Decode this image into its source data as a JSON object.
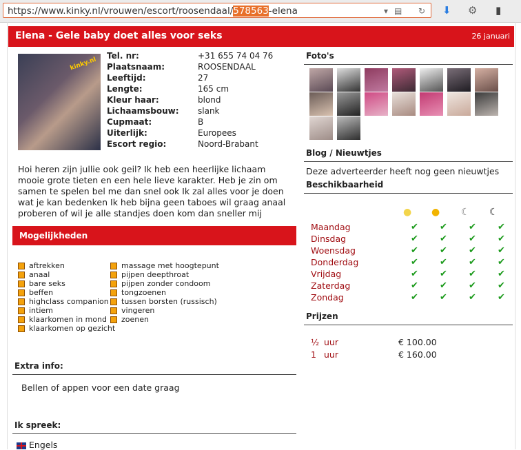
{
  "browser": {
    "url_prefix": "https://www.kinky.nl/vrouwen/escort/roosendaal/",
    "url_highlight": "578563",
    "url_suffix": "-elena"
  },
  "header": {
    "title": "Elena - Gele baby doet alles voor seks",
    "date": "26 januari"
  },
  "profile": {
    "photo_watermark": "kinky.nl",
    "fields": [
      {
        "label": "Tel. nr:",
        "value": "+31 655 74 04 76"
      },
      {
        "label": "Plaatsnaam:",
        "value": "ROOSENDAAL"
      },
      {
        "label": "Leeftijd:",
        "value": "27"
      },
      {
        "label": "Lengte:",
        "value": "165 cm"
      },
      {
        "label": "Kleur haar:",
        "value": "blond"
      },
      {
        "label": "Lichaamsbouw:",
        "value": "slank"
      },
      {
        "label": "Cupmaat:",
        "value": "B"
      },
      {
        "label": "Uiterlijk:",
        "value": "Europees"
      },
      {
        "label": "Escort regio:",
        "value": "Noord-Brabant"
      }
    ],
    "description_lines": [
      "Hoi heren zijn jullie ook geil? Ik heb een heerlijke lichaam",
      "mooie grote tieten en een hele lieve karakter. Heb je zin om",
      "samen te spelen bel me dan snel ook Ik zal alles voor je doen",
      "wat je kan bedenken Ik heb bijna geen taboes wil graag anaal",
      "proberen of wil je alle standjes doen kom dan sneller mij"
    ]
  },
  "mogelijkheden": {
    "title": "Mogelijkheden",
    "col1": [
      "aftrekken",
      "anaal",
      "bare seks",
      "beffen",
      "highclass companion",
      "intiem",
      "klaarkomen in mond",
      "klaarkomen op gezicht"
    ],
    "col2": [
      "massage met hoogtepunt",
      "pijpen deepthroat",
      "pijpen zonder condoom",
      "tongzoenen",
      "tussen borsten (russisch)",
      "vingeren",
      "zoenen"
    ]
  },
  "extra": {
    "title": "Extra info:",
    "text": "Bellen of appen voor een date graag"
  },
  "languages": {
    "title": "Ik spreek:",
    "items": [
      "Engels"
    ]
  },
  "fotos": {
    "title": "Foto's"
  },
  "blog": {
    "title": "Blog / Nieuwtjes",
    "text": "Deze adverteerder heeft nog geen nieuwtjes"
  },
  "beschikbaarheid": {
    "title": "Beschikbaarheid",
    "days": [
      "Maandag",
      "Dinsdag",
      "Woensdag",
      "Donderdag",
      "Vrijdag",
      "Zaterdag",
      "Zondag"
    ],
    "check_glyph": "✔"
  },
  "prijzen": {
    "title": "Prijzen",
    "rows": [
      {
        "qty": "½",
        "unit": "uur",
        "price": "€ 100.00"
      },
      {
        "qty": "1",
        "unit": "uur",
        "price": "€ 160.00"
      }
    ]
  },
  "colors": {
    "accent": "#d8141b",
    "day_text": "#a00d12",
    "check": "#1b9a1b"
  }
}
